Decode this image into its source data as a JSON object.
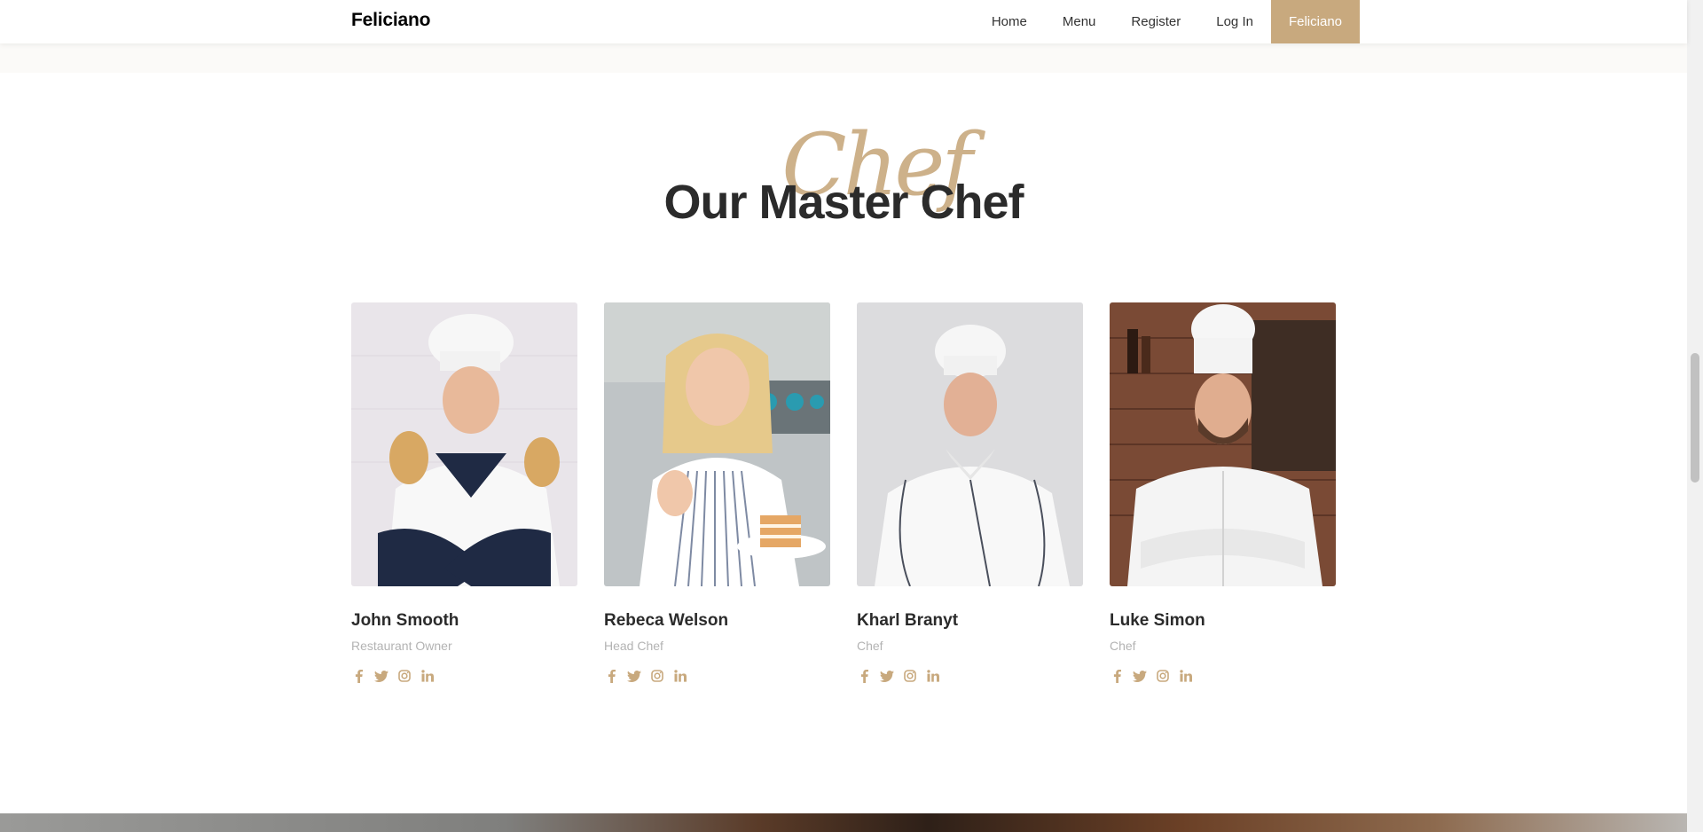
{
  "nav": {
    "brand": "Feliciano",
    "links": [
      "Home",
      "Menu",
      "Register",
      "Log In"
    ],
    "cta": "Feliciano"
  },
  "section": {
    "subheading": "Chef",
    "heading": "Our Master Chef"
  },
  "staff": [
    {
      "name": "John Smooth",
      "role": "Restaurant Owner",
      "photo_bg": "#e9e5ea"
    },
    {
      "name": "Rebeca Welson",
      "role": "Head Chef",
      "photo_bg": "#bfc4c6"
    },
    {
      "name": "Kharl Branyt",
      "role": "Chef",
      "photo_bg": "#dcdcde"
    },
    {
      "name": "Luke Simon",
      "role": "Chef",
      "photo_bg": "#7a4a35"
    }
  ],
  "social_icons": [
    "facebook-icon",
    "twitter-icon",
    "instagram-icon",
    "linkedin-icon"
  ],
  "colors": {
    "accent": "#c8a97e",
    "heading": "#2b2b2b",
    "muted": "#b3b3b3"
  }
}
